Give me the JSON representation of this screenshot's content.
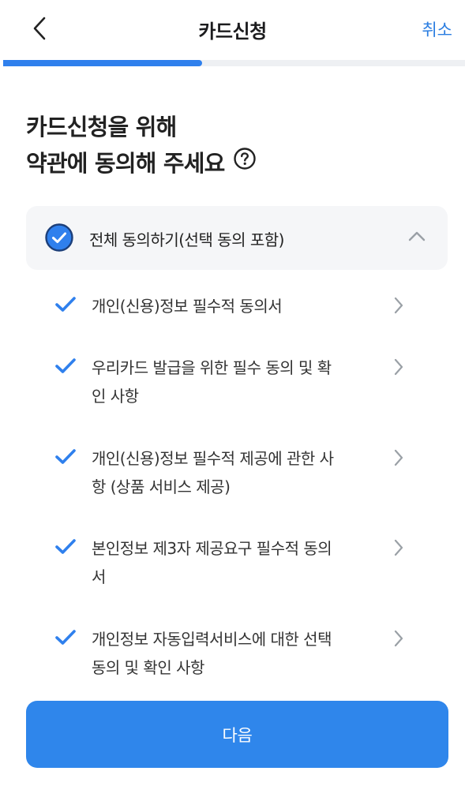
{
  "header": {
    "title": "카드신청",
    "cancel_label": "취소"
  },
  "progress": {
    "fraction": 0.43
  },
  "heading": {
    "line1": "카드신청을 위해",
    "line2": "약관에 동의해 주세요"
  },
  "all_agree": {
    "label": "전체 동의하기(선택 동의 포함)",
    "checked": true,
    "expanded": true
  },
  "terms": [
    {
      "line1": "개인(신용)정보 필수적 동의서",
      "line2": "",
      "checked": true
    },
    {
      "line1": "우리카드 발급을 위한 필수 동의 및 확",
      "line2": "인 사항",
      "checked": true
    },
    {
      "line1": "개인(신용)정보 필수적 제공에 관한 사",
      "line2": "항 (상품 서비스 제공)",
      "checked": true
    },
    {
      "line1": "본인정보 제3자 제공요구 필수적 동의",
      "line2": "서",
      "checked": true
    },
    {
      "line1": "개인정보 자동입력서비스에 대한 선택",
      "line2": "동의 및 확인 사항",
      "checked": true
    }
  ],
  "footer": {
    "next_label": "다음"
  },
  "colors": {
    "accent": "#2f86eb",
    "check": "#2f80ed",
    "chevron": "#9aa0a6"
  }
}
